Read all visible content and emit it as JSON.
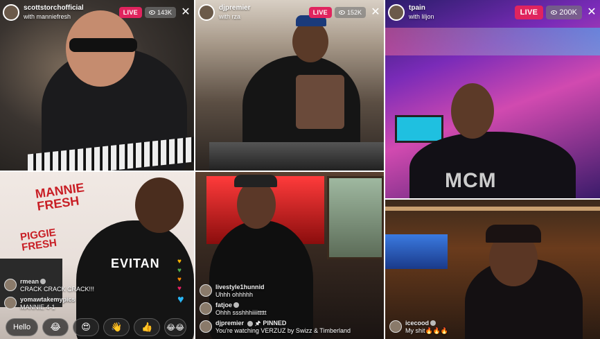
{
  "panels": [
    {
      "username": "scottstorchofficial",
      "with_text": "with manniefresh",
      "live": "LIVE",
      "viewers": "143K"
    },
    {
      "username": "djpremier",
      "with_text": "with rza",
      "live": "LIVE",
      "viewers": "152K"
    },
    {
      "username": "tpain",
      "with_text": "with liljon",
      "live": "LIVE",
      "viewers": "200K"
    }
  ],
  "p4": {
    "sign_top": "MANNIE FRESH",
    "sign_bottom": "PIGGIE FRESH",
    "shirt": "EVITAN",
    "comments": [
      {
        "user": "rmean",
        "verified": true,
        "msg": "CRACK CRACK CRACK!!!"
      },
      {
        "user": "yomawtakemypics",
        "verified": false,
        "msg": "MANNIE 4-1"
      }
    ],
    "reply": {
      "hello": "Hello",
      "emojis": [
        "😂",
        "😍",
        "👋",
        "👍",
        "😂😂"
      ]
    }
  },
  "p3": {
    "shirt": "MCM"
  },
  "p5": {
    "comments": [
      {
        "user": "livestyle1hunnid",
        "verified": false,
        "msg": "Uhhh ohhhhh"
      },
      {
        "user": "fatjoe",
        "verified": true,
        "msg": "Ohhh ssshhhiiiittttt"
      },
      {
        "user": "djpremier",
        "verified": true,
        "pinned": "PINNED",
        "msg": "You're watching VERZUZ by Swizz & Timberland"
      }
    ]
  },
  "p6": {
    "comments": [
      {
        "user": "icecood",
        "verified": true,
        "msg": "My shit🔥🔥🔥"
      }
    ]
  },
  "colors": {
    "live": "#e0245e",
    "sign": "#c81e25"
  }
}
